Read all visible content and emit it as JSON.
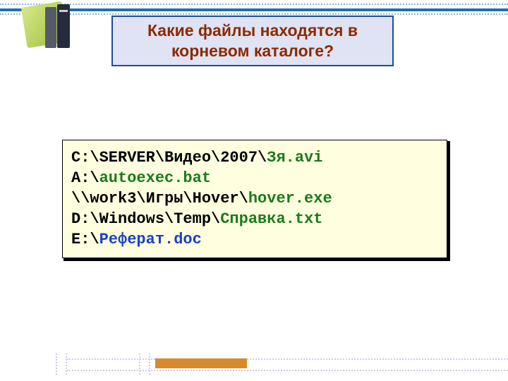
{
  "title": "Какие файлы  находятся в корневом  каталоге?",
  "lines": [
    {
      "pre": "C:\\SERVER\\Видео\\2007\\",
      "file": "Зя.avi",
      "cls": "g"
    },
    {
      "pre": "A:\\",
      "file": "autoexec.bat",
      "cls": "g"
    },
    {
      "pre": "\\\\work3\\Игры\\Hover\\",
      "file": "hover.exe",
      "cls": "g"
    },
    {
      "pre": "D:\\Windows\\Temp\\",
      "file": "Справка.txt",
      "cls": "g"
    },
    {
      "pre": "E:\\",
      "file": "Реферат.doc",
      "cls": "b"
    }
  ]
}
